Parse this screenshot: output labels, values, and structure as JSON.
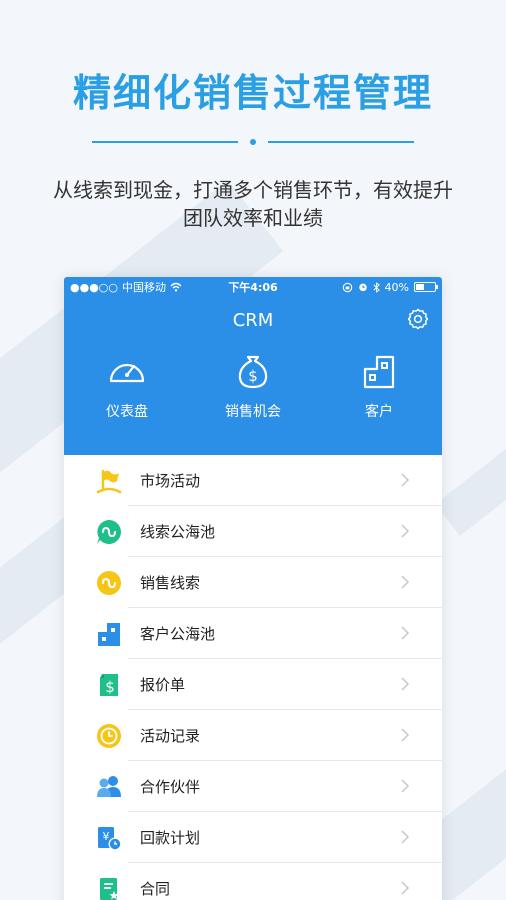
{
  "promo": {
    "title": "精细化销售过程管理",
    "subtitle": "从线索到现金，打通多个销售环节，有效提升团队效率和业绩"
  },
  "status_bar": {
    "signal": "●●●○○",
    "carrier": "中国移动",
    "time": "下午4:06",
    "battery": "40%"
  },
  "navbar": {
    "title": "CRM",
    "settings_icon": "gear-icon"
  },
  "quick_actions": [
    {
      "label": "仪表盘",
      "icon": "dashboard-icon"
    },
    {
      "label": "销售机会",
      "icon": "dollar-bag-icon"
    },
    {
      "label": "客户",
      "icon": "building-icon"
    }
  ],
  "menu": [
    {
      "label": "市场活动",
      "icon": "flag-icon"
    },
    {
      "label": "线索公海池",
      "icon": "clue-pool-icon"
    },
    {
      "label": "销售线索",
      "icon": "clue-icon"
    },
    {
      "label": "客户公海池",
      "icon": "customer-pool-icon"
    },
    {
      "label": "报价单",
      "icon": "quote-icon"
    },
    {
      "label": "活动记录",
      "icon": "clock-icon"
    },
    {
      "label": "合作伙伴",
      "icon": "partners-icon"
    },
    {
      "label": "回款计划",
      "icon": "payment-plan-icon"
    },
    {
      "label": "合同",
      "icon": "contract-icon"
    }
  ],
  "colors": {
    "brand_blue": "#2b8fe8",
    "title_blue": "#2a9fe3",
    "green": "#1fbf8c",
    "yellow": "#f5c518",
    "icon_blue": "#2b8fe8"
  }
}
